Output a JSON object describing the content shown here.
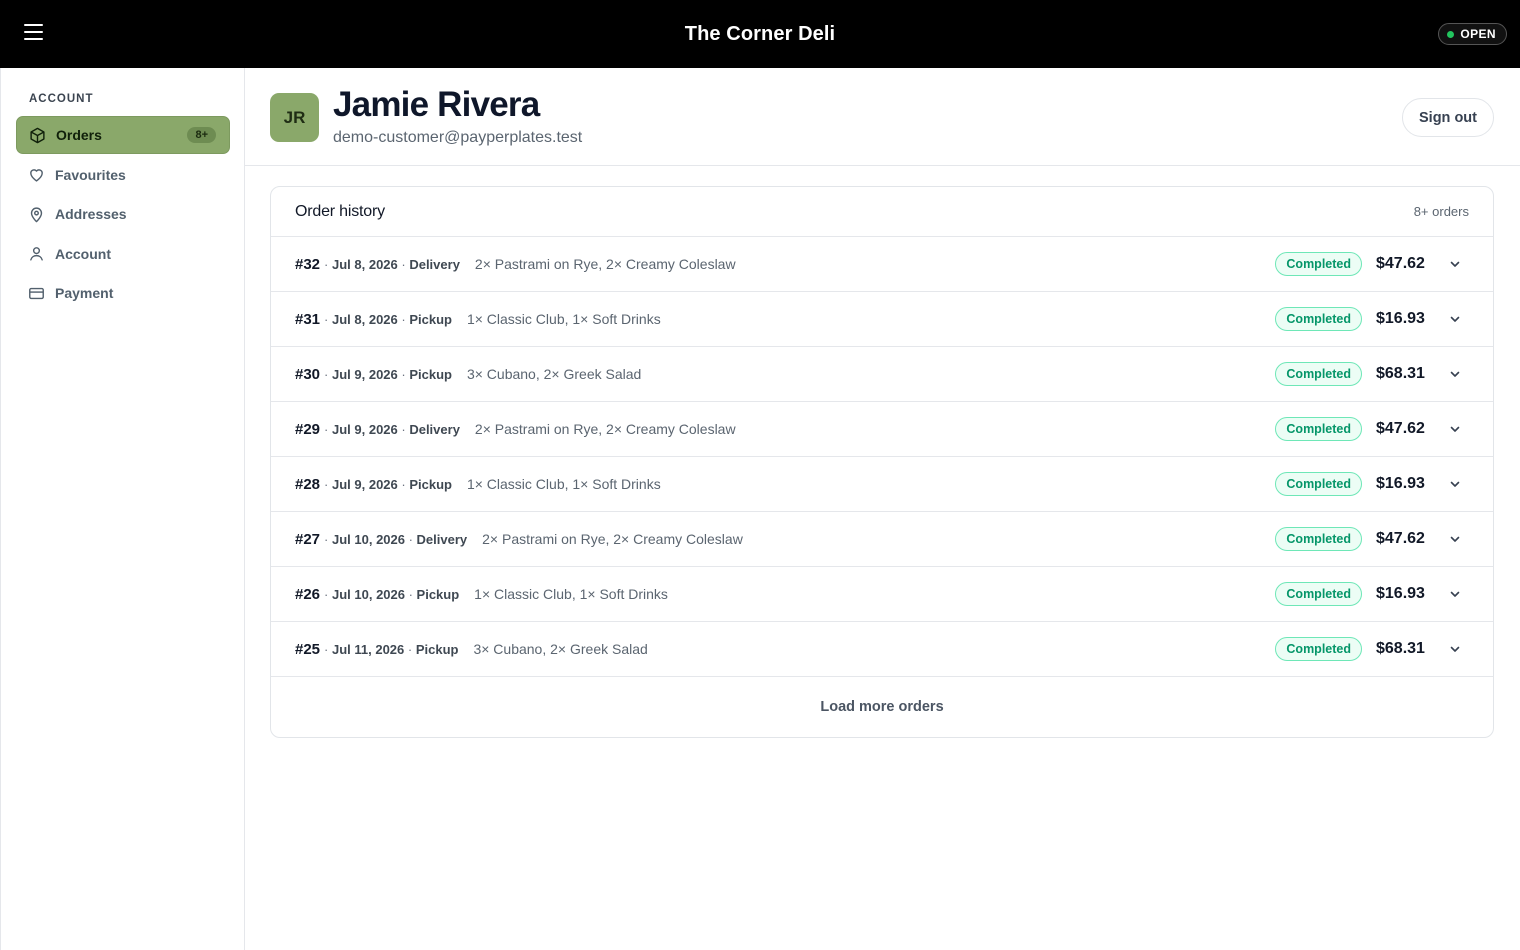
{
  "header": {
    "title": "The Corner Deli",
    "status": "OPEN",
    "status_color": "#22c55e"
  },
  "sidebar": {
    "heading": "ACCOUNT",
    "items": [
      {
        "label": "Orders",
        "icon": "box-icon",
        "badge": "8+",
        "active": true
      },
      {
        "label": "Favourites",
        "icon": "heart-icon"
      },
      {
        "label": "Addresses",
        "icon": "map-pin-icon"
      },
      {
        "label": "Account",
        "icon": "user-icon"
      },
      {
        "label": "Payment",
        "icon": "credit-card-icon"
      }
    ]
  },
  "profile": {
    "initials": "JR",
    "name": "Jamie Rivera",
    "email": "demo-customer@payperplates.test",
    "sign_out": "Sign out"
  },
  "orders": {
    "title": "Order history",
    "count": "8+ orders",
    "rows": [
      {
        "number": "#32",
        "date": "Jul 8, 2026",
        "type": "Delivery",
        "items": "2× Pastrami on Rye, 2× Creamy Coleslaw",
        "status": "Completed",
        "total": "$47.62"
      },
      {
        "number": "#31",
        "date": "Jul 8, 2026",
        "type": "Pickup",
        "items": "1× Classic Club, 1× Soft Drinks",
        "status": "Completed",
        "total": "$16.93"
      },
      {
        "number": "#30",
        "date": "Jul 9, 2026",
        "type": "Pickup",
        "items": "3× Cubano, 2× Greek Salad",
        "status": "Completed",
        "total": "$68.31"
      },
      {
        "number": "#29",
        "date": "Jul 9, 2026",
        "type": "Delivery",
        "items": "2× Pastrami on Rye, 2× Creamy Coleslaw",
        "status": "Completed",
        "total": "$47.62"
      },
      {
        "number": "#28",
        "date": "Jul 9, 2026",
        "type": "Pickup",
        "items": "1× Classic Club, 1× Soft Drinks",
        "status": "Completed",
        "total": "$16.93"
      },
      {
        "number": "#27",
        "date": "Jul 10, 2026",
        "type": "Delivery",
        "items": "2× Pastrami on Rye, 2× Creamy Coleslaw",
        "status": "Completed",
        "total": "$47.62"
      },
      {
        "number": "#26",
        "date": "Jul 10, 2026",
        "type": "Pickup",
        "items": "1× Classic Club, 1× Soft Drinks",
        "status": "Completed",
        "total": "$16.93"
      },
      {
        "number": "#25",
        "date": "Jul 11, 2026",
        "type": "Pickup",
        "items": "3× Cubano, 2× Greek Salad",
        "status": "Completed",
        "total": "$68.31"
      }
    ],
    "load_more": "Load more orders"
  },
  "colors": {
    "accent": "#8aa86a",
    "status_completed": "#059669"
  }
}
